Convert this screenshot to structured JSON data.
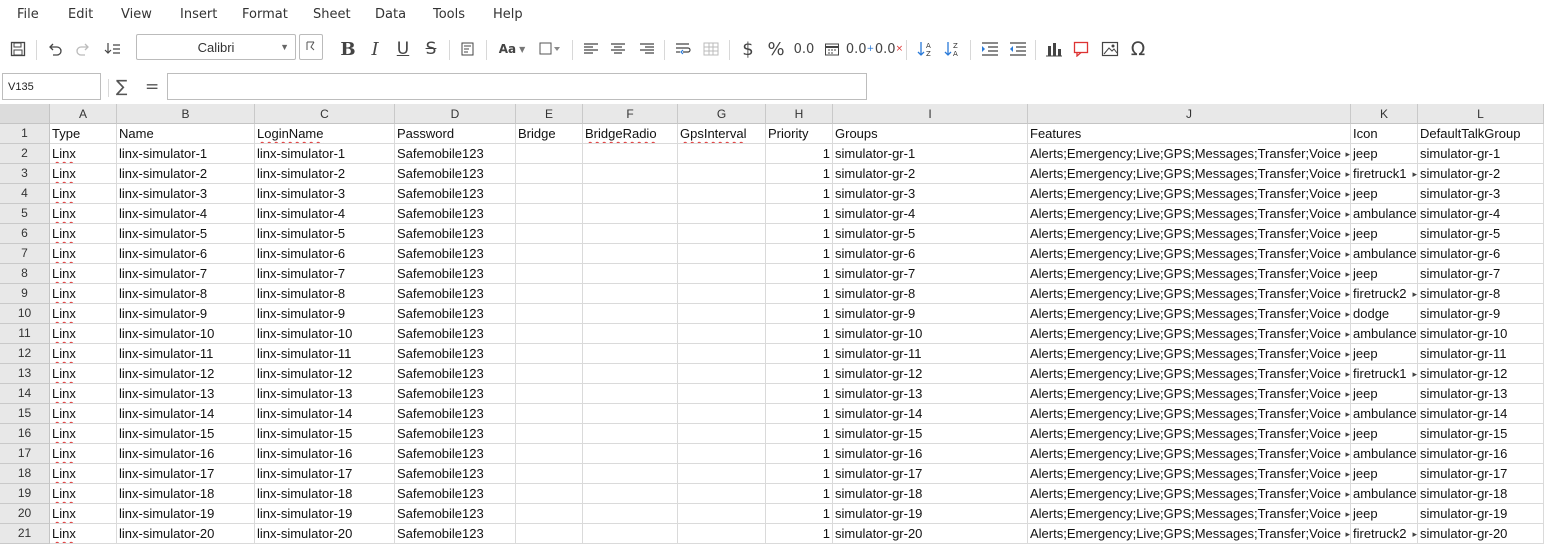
{
  "menu": [
    "File",
    "Edit",
    "View",
    "Insert",
    "Format",
    "Sheet",
    "Data",
    "Tools",
    "Help"
  ],
  "toolbar": {
    "font_name": "Calibri",
    "bold": "B",
    "italic": "I",
    "underline": "U",
    "strike": "S",
    "case": "Aa",
    "currency": "$",
    "percent": "%",
    "dec1": "0.0",
    "dec2": "0.0",
    "omega": "Ω"
  },
  "formula": {
    "cell_ref": "V135",
    "value": ""
  },
  "columns": [
    {
      "letter": "A",
      "w": 67
    },
    {
      "letter": "B",
      "w": 138
    },
    {
      "letter": "C",
      "w": 140
    },
    {
      "letter": "D",
      "w": 121
    },
    {
      "letter": "E",
      "w": 67
    },
    {
      "letter": "F",
      "w": 95
    },
    {
      "letter": "G",
      "w": 88
    },
    {
      "letter": "H",
      "w": 67
    },
    {
      "letter": "I",
      "w": 195
    },
    {
      "letter": "J",
      "w": 323
    },
    {
      "letter": "K",
      "w": 67
    },
    {
      "letter": "L",
      "w": 126
    }
  ],
  "header_row": [
    "Type",
    "Name",
    "LoginName",
    "Password",
    "Bridge",
    "BridgeRadio",
    "GpsInterval",
    "Priority",
    "Groups",
    "Features",
    "Icon",
    "DefaultTalkGroup"
  ],
  "rows": [
    [
      "Linx",
      "linx-simulator-1",
      "linx-simulator-1",
      "Safemobile123",
      "",
      "",
      "",
      "1",
      "simulator-gr-1",
      "Alerts;Emergency;Live;GPS;Messages;Transfer;Voice",
      "jeep",
      "simulator-gr-1"
    ],
    [
      "Linx",
      "linx-simulator-2",
      "linx-simulator-2",
      "Safemobile123",
      "",
      "",
      "",
      "1",
      "simulator-gr-2",
      "Alerts;Emergency;Live;GPS;Messages;Transfer;Voice",
      "firetruck1",
      "simulator-gr-2"
    ],
    [
      "Linx",
      "linx-simulator-3",
      "linx-simulator-3",
      "Safemobile123",
      "",
      "",
      "",
      "1",
      "simulator-gr-3",
      "Alerts;Emergency;Live;GPS;Messages;Transfer;Voice",
      "jeep",
      "simulator-gr-3"
    ],
    [
      "Linx",
      "linx-simulator-4",
      "linx-simulator-4",
      "Safemobile123",
      "",
      "",
      "",
      "1",
      "simulator-gr-4",
      "Alerts;Emergency;Live;GPS;Messages;Transfer;Voice",
      "ambulance",
      "simulator-gr-4"
    ],
    [
      "Linx",
      "linx-simulator-5",
      "linx-simulator-5",
      "Safemobile123",
      "",
      "",
      "",
      "1",
      "simulator-gr-5",
      "Alerts;Emergency;Live;GPS;Messages;Transfer;Voice",
      "jeep",
      "simulator-gr-5"
    ],
    [
      "Linx",
      "linx-simulator-6",
      "linx-simulator-6",
      "Safemobile123",
      "",
      "",
      "",
      "1",
      "simulator-gr-6",
      "Alerts;Emergency;Live;GPS;Messages;Transfer;Voice",
      "ambulance",
      "simulator-gr-6"
    ],
    [
      "Linx",
      "linx-simulator-7",
      "linx-simulator-7",
      "Safemobile123",
      "",
      "",
      "",
      "1",
      "simulator-gr-7",
      "Alerts;Emergency;Live;GPS;Messages;Transfer;Voice",
      "jeep",
      "simulator-gr-7"
    ],
    [
      "Linx",
      "linx-simulator-8",
      "linx-simulator-8",
      "Safemobile123",
      "",
      "",
      "",
      "1",
      "simulator-gr-8",
      "Alerts;Emergency;Live;GPS;Messages;Transfer;Voice",
      "firetruck2",
      "simulator-gr-8"
    ],
    [
      "Linx",
      "linx-simulator-9",
      "linx-simulator-9",
      "Safemobile123",
      "",
      "",
      "",
      "1",
      "simulator-gr-9",
      "Alerts;Emergency;Live;GPS;Messages;Transfer;Voice",
      "dodge",
      "simulator-gr-9"
    ],
    [
      "Linx",
      "linx-simulator-10",
      "linx-simulator-10",
      "Safemobile123",
      "",
      "",
      "",
      "1",
      "simulator-gr-10",
      "Alerts;Emergency;Live;GPS;Messages;Transfer;Voice",
      "ambulance",
      "simulator-gr-10"
    ],
    [
      "Linx",
      "linx-simulator-11",
      "linx-simulator-11",
      "Safemobile123",
      "",
      "",
      "",
      "1",
      "simulator-gr-11",
      "Alerts;Emergency;Live;GPS;Messages;Transfer;Voice",
      "jeep",
      "simulator-gr-11"
    ],
    [
      "Linx",
      "linx-simulator-12",
      "linx-simulator-12",
      "Safemobile123",
      "",
      "",
      "",
      "1",
      "simulator-gr-12",
      "Alerts;Emergency;Live;GPS;Messages;Transfer;Voice",
      "firetruck1",
      "simulator-gr-12"
    ],
    [
      "Linx",
      "linx-simulator-13",
      "linx-simulator-13",
      "Safemobile123",
      "",
      "",
      "",
      "1",
      "simulator-gr-13",
      "Alerts;Emergency;Live;GPS;Messages;Transfer;Voice",
      "jeep",
      "simulator-gr-13"
    ],
    [
      "Linx",
      "linx-simulator-14",
      "linx-simulator-14",
      "Safemobile123",
      "",
      "",
      "",
      "1",
      "simulator-gr-14",
      "Alerts;Emergency;Live;GPS;Messages;Transfer;Voice",
      "ambulance",
      "simulator-gr-14"
    ],
    [
      "Linx",
      "linx-simulator-15",
      "linx-simulator-15",
      "Safemobile123",
      "",
      "",
      "",
      "1",
      "simulator-gr-15",
      "Alerts;Emergency;Live;GPS;Messages;Transfer;Voice",
      "jeep",
      "simulator-gr-15"
    ],
    [
      "Linx",
      "linx-simulator-16",
      "linx-simulator-16",
      "Safemobile123",
      "",
      "",
      "",
      "1",
      "simulator-gr-16",
      "Alerts;Emergency;Live;GPS;Messages;Transfer;Voice",
      "ambulance",
      "simulator-gr-16"
    ],
    [
      "Linx",
      "linx-simulator-17",
      "linx-simulator-17",
      "Safemobile123",
      "",
      "",
      "",
      "1",
      "simulator-gr-17",
      "Alerts;Emergency;Live;GPS;Messages;Transfer;Voice",
      "jeep",
      "simulator-gr-17"
    ],
    [
      "Linx",
      "linx-simulator-18",
      "linx-simulator-18",
      "Safemobile123",
      "",
      "",
      "",
      "1",
      "simulator-gr-18",
      "Alerts;Emergency;Live;GPS;Messages;Transfer;Voice",
      "ambulance",
      "simulator-gr-18"
    ],
    [
      "Linx",
      "linx-simulator-19",
      "linx-simulator-19",
      "Safemobile123",
      "",
      "",
      "",
      "1",
      "simulator-gr-19",
      "Alerts;Emergency;Live;GPS;Messages;Transfer;Voice",
      "jeep",
      "simulator-gr-19"
    ],
    [
      "Linx",
      "linx-simulator-20",
      "linx-simulator-20",
      "Safemobile123",
      "",
      "",
      "",
      "1",
      "simulator-gr-20",
      "Alerts;Emergency;Live;GPS;Messages;Transfer;Voice",
      "firetruck2",
      "simulator-gr-20"
    ]
  ]
}
